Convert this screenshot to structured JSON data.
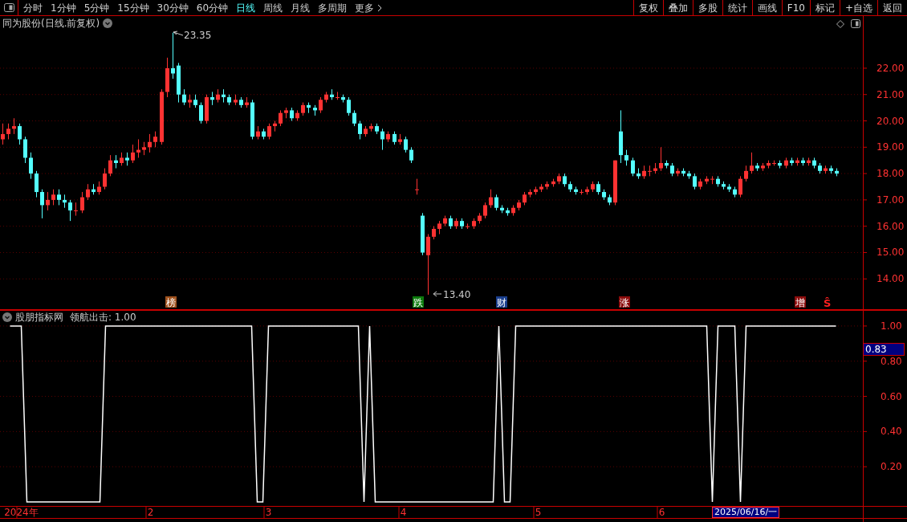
{
  "toolbar": {
    "periods": [
      {
        "label": "分时",
        "selected": false
      },
      {
        "label": "1分钟",
        "selected": false
      },
      {
        "label": "5分钟",
        "selected": false
      },
      {
        "label": "15分钟",
        "selected": false
      },
      {
        "label": "30分钟",
        "selected": false
      },
      {
        "label": "60分钟",
        "selected": false
      },
      {
        "label": "日线",
        "selected": true
      },
      {
        "label": "周线",
        "selected": false
      },
      {
        "label": "月线",
        "selected": false
      },
      {
        "label": "多周期",
        "selected": false
      },
      {
        "label": "更多",
        "selected": false
      }
    ],
    "actions": [
      "复权",
      "叠加",
      "多股",
      "统计",
      "画线",
      "F10",
      "标记",
      "+自选",
      "返回"
    ]
  },
  "main_chart": {
    "title": "同为股份(日线.前复权)",
    "high_label": "23.35",
    "low_label": "13.40",
    "chart_data": {
      "type": "candlestick",
      "categories": [
        null,
        null,
        null,
        null,
        null,
        null,
        null,
        null,
        null,
        null,
        null,
        null,
        null,
        null,
        null,
        null,
        null,
        null,
        null,
        null,
        null,
        null,
        null,
        null,
        null,
        null,
        null,
        null,
        null,
        null,
        null,
        null,
        null,
        null,
        null,
        null,
        null,
        null,
        null,
        null,
        null,
        null,
        null,
        null,
        null,
        null,
        null,
        null,
        null,
        null,
        null,
        null,
        null,
        null,
        null,
        null,
        null,
        null,
        null,
        null,
        null,
        null,
        null,
        null,
        null,
        null,
        null,
        null,
        null,
        null,
        null,
        null,
        null,
        null,
        null,
        null,
        null,
        null,
        null,
        null,
        null,
        null,
        null,
        null,
        null,
        null,
        null,
        null,
        null,
        null,
        null,
        null,
        null,
        null,
        null,
        null,
        null,
        null,
        null,
        null,
        null,
        null,
        null,
        null,
        null,
        null,
        null,
        null,
        null,
        null,
        null,
        null,
        null,
        null,
        null,
        null,
        null,
        null,
        null,
        null,
        null,
        null,
        null,
        null,
        null,
        null,
        null,
        null,
        null,
        null,
        null,
        null,
        null,
        null,
        null,
        null,
        null,
        null,
        null,
        null,
        null,
        null,
        null,
        null,
        null,
        null,
        null,
        null,
        null,
        null,
        null,
        null
      ],
      "ohlc": [
        [
          19.3,
          19.9,
          19.1,
          19.5
        ],
        [
          19.5,
          19.9,
          19.3,
          19.7
        ],
        [
          19.7,
          20.1,
          19.5,
          19.8
        ],
        [
          19.8,
          19.9,
          19.1,
          19.3
        ],
        [
          19.3,
          19.4,
          18.4,
          18.6
        ],
        [
          18.6,
          18.8,
          17.8,
          18.0
        ],
        [
          18.0,
          18.1,
          17.1,
          17.3
        ],
        [
          17.3,
          17.4,
          16.3,
          16.8
        ],
        [
          16.8,
          17.3,
          16.6,
          17.0
        ],
        [
          17.0,
          17.4,
          16.8,
          17.2
        ],
        [
          17.2,
          17.4,
          16.8,
          17.0
        ],
        [
          17.0,
          17.2,
          16.7,
          16.9
        ],
        [
          16.9,
          17.0,
          16.2,
          16.6
        ],
        [
          16.6,
          16.9,
          16.4,
          16.6
        ],
        [
          16.6,
          17.3,
          16.5,
          17.1
        ],
        [
          17.1,
          17.6,
          17.0,
          17.4
        ],
        [
          17.4,
          17.6,
          17.2,
          17.3
        ],
        [
          17.3,
          17.7,
          17.2,
          17.5
        ],
        [
          17.5,
          18.2,
          17.4,
          18.0
        ],
        [
          18.0,
          18.7,
          17.9,
          18.5
        ],
        [
          18.5,
          18.7,
          18.2,
          18.4
        ],
        [
          18.4,
          18.8,
          18.3,
          18.6
        ],
        [
          18.6,
          18.8,
          18.3,
          18.5
        ],
        [
          18.5,
          19.1,
          18.4,
          18.8
        ],
        [
          18.8,
          19.3,
          18.6,
          18.9
        ],
        [
          18.9,
          19.2,
          18.7,
          19.0
        ],
        [
          19.0,
          19.5,
          18.8,
          19.2
        ],
        [
          19.2,
          19.6,
          19.0,
          19.4
        ],
        [
          19.2,
          21.2,
          19.1,
          21.1
        ],
        [
          21.1,
          22.4,
          20.9,
          22.0
        ],
        [
          22.0,
          23.35,
          21.6,
          21.8
        ],
        [
          22.1,
          22.2,
          20.7,
          21.0
        ],
        [
          21.0,
          21.2,
          20.6,
          20.7
        ],
        [
          20.7,
          21.0,
          20.5,
          20.8
        ],
        [
          20.8,
          21.0,
          20.5,
          20.6
        ],
        [
          20.6,
          20.7,
          19.9,
          20.0
        ],
        [
          20.0,
          21.0,
          19.9,
          20.9
        ],
        [
          20.9,
          21.1,
          20.6,
          20.8
        ],
        [
          20.8,
          21.2,
          20.7,
          21.0
        ],
        [
          21.0,
          21.2,
          20.7,
          20.9
        ],
        [
          20.9,
          21.0,
          20.6,
          20.7
        ],
        [
          20.7,
          21.0,
          20.6,
          20.8
        ],
        [
          20.8,
          20.9,
          20.5,
          20.6
        ],
        [
          20.6,
          20.9,
          20.5,
          20.7
        ],
        [
          20.7,
          20.8,
          19.3,
          19.4
        ],
        [
          19.4,
          19.8,
          19.3,
          19.6
        ],
        [
          19.6,
          19.7,
          19.3,
          19.4
        ],
        [
          19.4,
          19.9,
          19.3,
          19.8
        ],
        [
          19.8,
          20.0,
          19.6,
          19.9
        ],
        [
          19.9,
          20.4,
          19.8,
          20.3
        ],
        [
          20.3,
          20.5,
          20.1,
          20.4
        ],
        [
          20.4,
          20.5,
          20.0,
          20.1
        ],
        [
          20.1,
          20.4,
          20.0,
          20.3
        ],
        [
          20.3,
          20.7,
          20.2,
          20.6
        ],
        [
          20.6,
          20.7,
          20.3,
          20.5
        ],
        [
          20.5,
          20.6,
          20.2,
          20.4
        ],
        [
          20.4,
          20.9,
          20.3,
          20.8
        ],
        [
          20.8,
          21.1,
          20.7,
          21.0
        ],
        [
          21.0,
          21.2,
          20.8,
          20.9
        ],
        [
          20.9,
          21.1,
          20.8,
          20.9
        ],
        [
          20.9,
          21.0,
          20.7,
          20.8
        ],
        [
          20.8,
          20.9,
          20.2,
          20.3
        ],
        [
          20.3,
          20.4,
          19.8,
          19.9
        ],
        [
          19.9,
          20.0,
          19.3,
          19.5
        ],
        [
          19.5,
          19.8,
          19.4,
          19.7
        ],
        [
          19.7,
          19.9,
          19.6,
          19.8
        ],
        [
          19.8,
          19.9,
          19.5,
          19.6
        ],
        [
          19.6,
          19.7,
          18.9,
          19.3
        ],
        [
          19.3,
          19.6,
          19.2,
          19.5
        ],
        [
          19.5,
          19.6,
          19.1,
          19.2
        ],
        [
          19.2,
          19.5,
          19.1,
          19.3
        ],
        [
          19.3,
          19.4,
          18.8,
          18.9
        ],
        [
          18.9,
          19.0,
          18.4,
          18.5
        ],
        [
          17.4,
          17.8,
          17.2,
          17.4
        ],
        [
          16.4,
          16.5,
          14.9,
          15.0
        ],
        [
          14.9,
          15.7,
          13.4,
          15.6
        ],
        [
          15.6,
          16.0,
          15.5,
          15.9
        ],
        [
          15.9,
          16.2,
          15.7,
          16.1
        ],
        [
          16.1,
          16.4,
          16.0,
          16.3
        ],
        [
          16.3,
          16.4,
          15.9,
          16.0
        ],
        [
          16.0,
          16.3,
          15.9,
          16.2
        ],
        [
          16.2,
          16.3,
          15.9,
          16.0
        ],
        [
          16.0,
          16.1,
          15.9,
          16.0
        ],
        [
          16.0,
          16.3,
          15.9,
          16.2
        ],
        [
          16.2,
          16.5,
          16.1,
          16.4
        ],
        [
          16.4,
          16.9,
          16.3,
          16.8
        ],
        [
          16.8,
          17.4,
          16.7,
          17.1
        ],
        [
          17.1,
          17.2,
          16.6,
          16.7
        ],
        [
          16.7,
          16.8,
          16.5,
          16.6
        ],
        [
          16.6,
          16.7,
          16.4,
          16.5
        ],
        [
          16.5,
          16.8,
          16.4,
          16.7
        ],
        [
          16.7,
          17.0,
          16.6,
          16.9
        ],
        [
          16.9,
          17.3,
          16.8,
          17.2
        ],
        [
          17.2,
          17.4,
          17.1,
          17.3
        ],
        [
          17.3,
          17.5,
          17.2,
          17.4
        ],
        [
          17.4,
          17.6,
          17.3,
          17.5
        ],
        [
          17.5,
          17.7,
          17.4,
          17.6
        ],
        [
          17.6,
          17.8,
          17.5,
          17.7
        ],
        [
          17.7,
          18.0,
          17.6,
          17.9
        ],
        [
          17.9,
          18.0,
          17.5,
          17.6
        ],
        [
          17.6,
          17.7,
          17.3,
          17.4
        ],
        [
          17.4,
          17.5,
          17.2,
          17.3
        ],
        [
          17.3,
          17.4,
          17.2,
          17.3
        ],
        [
          17.3,
          17.5,
          17.2,
          17.4
        ],
        [
          17.4,
          17.7,
          17.3,
          17.6
        ],
        [
          17.6,
          17.7,
          17.2,
          17.3
        ],
        [
          17.3,
          17.4,
          17.0,
          17.1
        ],
        [
          17.1,
          17.2,
          16.8,
          16.9
        ],
        [
          16.9,
          18.5,
          16.8,
          18.5
        ],
        [
          19.6,
          20.4,
          18.4,
          18.7
        ],
        [
          18.7,
          18.9,
          18.3,
          18.5
        ],
        [
          18.5,
          18.6,
          17.9,
          18.0
        ],
        [
          18.0,
          18.2,
          17.8,
          17.9
        ],
        [
          17.9,
          18.3,
          17.8,
          18.1
        ],
        [
          18.1,
          18.3,
          17.9,
          18.1
        ],
        [
          18.1,
          18.4,
          18.0,
          18.2
        ],
        [
          18.2,
          19.0,
          18.1,
          18.4
        ],
        [
          18.4,
          18.5,
          18.2,
          18.3
        ],
        [
          18.3,
          18.4,
          17.9,
          18.0
        ],
        [
          18.0,
          18.2,
          17.9,
          18.1
        ],
        [
          18.1,
          18.2,
          17.9,
          18.0
        ],
        [
          18.0,
          18.1,
          17.8,
          17.9
        ],
        [
          17.9,
          18.0,
          17.4,
          17.5
        ],
        [
          17.5,
          17.8,
          17.4,
          17.7
        ],
        [
          17.7,
          17.9,
          17.6,
          17.8
        ],
        [
          17.8,
          17.9,
          17.6,
          17.8
        ],
        [
          17.8,
          17.9,
          17.5,
          17.6
        ],
        [
          17.6,
          17.7,
          17.4,
          17.5
        ],
        [
          17.5,
          17.6,
          17.3,
          17.4
        ],
        [
          17.4,
          17.5,
          17.1,
          17.2
        ],
        [
          17.2,
          17.9,
          17.1,
          17.8
        ],
        [
          17.8,
          18.3,
          17.7,
          18.1
        ],
        [
          18.1,
          18.8,
          18.0,
          18.3
        ],
        [
          18.3,
          18.4,
          18.1,
          18.2
        ],
        [
          18.2,
          18.4,
          18.1,
          18.3
        ],
        [
          18.3,
          18.5,
          18.2,
          18.4
        ],
        [
          18.4,
          18.5,
          18.3,
          18.4
        ],
        [
          18.4,
          18.5,
          18.2,
          18.3
        ],
        [
          18.3,
          18.6,
          18.2,
          18.5
        ],
        [
          18.5,
          18.6,
          18.3,
          18.4
        ],
        [
          18.4,
          18.6,
          18.3,
          18.5
        ],
        [
          18.5,
          18.6,
          18.3,
          18.4
        ],
        [
          18.4,
          18.6,
          18.3,
          18.5
        ],
        [
          18.5,
          18.6,
          18.2,
          18.3
        ],
        [
          18.3,
          18.4,
          18.0,
          18.1
        ],
        [
          18.1,
          18.3,
          18.0,
          18.2
        ],
        [
          18.2,
          18.3,
          18.0,
          18.1
        ],
        [
          18.1,
          18.2,
          17.9,
          18.0
        ],
        null,
        null,
        null,
        null
      ],
      "grid": true,
      "ylim": [
        12.85,
        23.98
      ],
      "yticks": [
        {
          "value": 22,
          "label": "22.00"
        },
        {
          "value": 21,
          "label": "21.00"
        },
        {
          "value": 20,
          "label": "20.00"
        },
        {
          "value": 19,
          "label": "19.00"
        },
        {
          "value": 18,
          "label": "18.00"
        },
        {
          "value": 17,
          "label": "17.00"
        },
        {
          "value": 16,
          "label": "16.00"
        },
        {
          "value": 15,
          "label": "15.00"
        },
        {
          "value": 14,
          "label": "14.00"
        }
      ]
    },
    "event_tags": [
      {
        "label": "榜",
        "kind": "badge",
        "color": "#a0521e"
      },
      {
        "label": "跌",
        "kind": "badge",
        "color": "#0c7a0c"
      },
      {
        "label": "财",
        "kind": "badge",
        "color": "#1a3e8c"
      },
      {
        "label": "涨",
        "kind": "badge",
        "color": "#8b0c0c"
      },
      {
        "label": "增",
        "kind": "badge",
        "color": "#8b0c0c"
      },
      {
        "label": "Ŝ",
        "kind": "letter",
        "color": "#ff2020"
      }
    ]
  },
  "indicator": {
    "name": "股朋指标网",
    "legend_value": ": 1.00",
    "cursor_value": "0.83",
    "chart_data": {
      "type": "line",
      "categories": [
        null,
        null,
        "2024年",
        null,
        null,
        null,
        null,
        null,
        null,
        null,
        null,
        null,
        null,
        null,
        null,
        null,
        null,
        null,
        null,
        null,
        null,
        null,
        null,
        null,
        null,
        "2",
        null,
        null,
        null,
        null,
        null,
        null,
        null,
        null,
        null,
        null,
        null,
        null,
        null,
        null,
        null,
        null,
        null,
        null,
        null,
        null,
        "3",
        null,
        null,
        null,
        null,
        null,
        null,
        null,
        null,
        null,
        null,
        null,
        null,
        null,
        null,
        null,
        null,
        null,
        null,
        null,
        null,
        null,
        null,
        null,
        "4",
        null,
        null,
        null,
        null,
        null,
        null,
        null,
        null,
        null,
        null,
        null,
        null,
        null,
        null,
        null,
        null,
        null,
        null,
        null,
        null,
        null,
        null,
        null,
        "5",
        null,
        null,
        null,
        null,
        null,
        null,
        null,
        null,
        null,
        null,
        null,
        null,
        null,
        null,
        null,
        null,
        null,
        null,
        null,
        null,
        null,
        "6",
        null,
        null,
        null,
        null,
        null,
        null,
        null,
        null,
        null,
        null,
        null,
        null,
        null,
        null,
        null,
        null,
        null,
        null,
        null,
        null,
        null,
        null,
        null,
        null,
        null,
        null,
        null,
        null,
        null,
        null,
        null
      ],
      "series": [
        {
          "name": "领航出击",
          "color": "#ffffff",
          "values": [
            1,
            1,
            1,
            0,
            0,
            0,
            0,
            0,
            0,
            0,
            0,
            0,
            0,
            0,
            0,
            0,
            0,
            1,
            1,
            1,
            1,
            1,
            1,
            1,
            1,
            1,
            1,
            1,
            1,
            1,
            1,
            1,
            1,
            1,
            1,
            1,
            1,
            1,
            1,
            1,
            1,
            1,
            1,
            1,
            0,
            0,
            1,
            1,
            1,
            1,
            1,
            1,
            1,
            1,
            1,
            1,
            1,
            1,
            1,
            1,
            1,
            1,
            1,
            0,
            1,
            0,
            0,
            0,
            0,
            0,
            0,
            0,
            0,
            0,
            0,
            0,
            0,
            0,
            0,
            0,
            0,
            0,
            0,
            0,
            0,
            0,
            0,
            1,
            0,
            0,
            1,
            1,
            1,
            1,
            1,
            1,
            1,
            1,
            1,
            1,
            1,
            1,
            1,
            1,
            1,
            1,
            1,
            1,
            1,
            1,
            1,
            1,
            1,
            1,
            1,
            1,
            1,
            1,
            1,
            1,
            1,
            1,
            1,
            1,
            1,
            0,
            1,
            1,
            1,
            1,
            0,
            1,
            1,
            1,
            1,
            1,
            1,
            1,
            1,
            1,
            1,
            1,
            1,
            1,
            1,
            1,
            1,
            1
          ]
        }
      ],
      "grid": true,
      "ylim": [
        -0.023,
        1.091
      ],
      "yticks": [
        {
          "value": 0.2,
          "label": "0.20"
        },
        {
          "value": 0.4,
          "label": "0.40"
        },
        {
          "value": 0.6,
          "label": "0.60"
        },
        {
          "value": 0.8,
          "label": "0.80"
        },
        {
          "value": 1,
          "label": "1.00"
        }
      ]
    }
  },
  "time_axis": {
    "cursor_date": "2025/06/16/一"
  }
}
